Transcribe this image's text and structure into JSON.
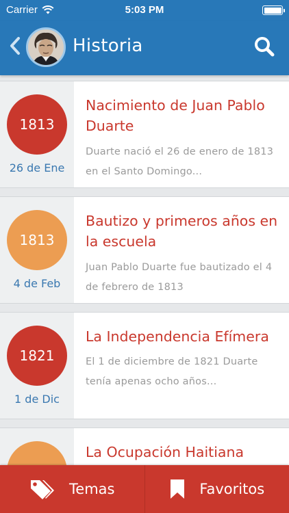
{
  "status_bar": {
    "carrier": "Carrier",
    "time": "5:03 PM",
    "wifi_icon": "wifi-icon",
    "battery_icon": "battery-icon",
    "battery_level": 1.0
  },
  "nav": {
    "title": "Historia",
    "back_icon": "chevron-left-icon",
    "search_icon": "search-icon",
    "color": "#2878b8"
  },
  "events": [
    {
      "year": "1813",
      "day": "26 de Ene",
      "title": "Nacimiento de Juan Pablo Duarte",
      "description": "Duarte nació el 26 de enero de 1813 en el Santo Domingo...",
      "color": "#c9382d"
    },
    {
      "year": "1813",
      "day": "4 de Feb",
      "title": "Bautizo y primeros años en la escuela",
      "description": "Juan Pablo Duarte fue bautizado el 4 de febrero de 1813",
      "color": "#ec9d52"
    },
    {
      "year": "1821",
      "day": "1 de Dic",
      "title": "La Independencia Efímera",
      "description": "El 1 de diciembre de 1821 Duarte tenía apenas ocho años...",
      "color": "#c9382d"
    },
    {
      "year": "",
      "day": "",
      "title": "La Ocupación Haitiana",
      "description": "",
      "color": "#ec9d52"
    }
  ],
  "tab_bar": {
    "color": "#c9382d",
    "tabs": [
      {
        "label": "Temas",
        "icon": "tags-icon"
      },
      {
        "label": "Favoritos",
        "icon": "bookmark-icon"
      }
    ]
  },
  "colors": {
    "accent_red": "#c9382d",
    "accent_orange": "#ec9d52",
    "date_blue": "#3a78b0",
    "description_gray": "#9a9a9a"
  }
}
